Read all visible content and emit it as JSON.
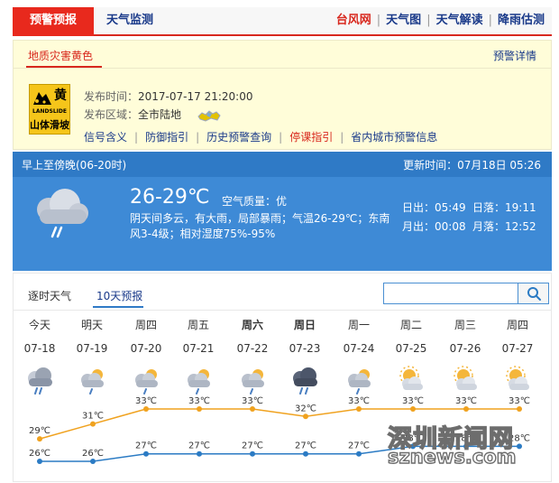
{
  "top_tabs": {
    "active": "预警预报",
    "second": "天气监测",
    "links": [
      {
        "label": "台风网",
        "red": true
      },
      {
        "label": "天气图",
        "red": false
      },
      {
        "label": "天气解读",
        "red": false
      },
      {
        "label": "降雨估测",
        "red": false
      }
    ]
  },
  "warning": {
    "title": "地质灾害黄色",
    "detail_link": "预警详情",
    "badge": {
      "level_char": "黄",
      "en": "LANDSLIDE",
      "cn": "山体滑坡"
    },
    "publish_label": "发布时间：",
    "publish_time": "2017-07-17 21:20:00",
    "area_label": "发布区域：",
    "area": "全市陆地",
    "actions": [
      "信号含义",
      "防御指引",
      "历史预警查询",
      "停课指引",
      "省内城市预警信息"
    ]
  },
  "forecast_panel": {
    "period": "早上至傍晚(06-20时)",
    "update_label": "更新时间：07月18日 05:26",
    "temp": "26-29℃",
    "aqi": "空气质量：优",
    "description": "阴天间多云，有大雨，局部暴雨；气温26-29℃；东南风3-4级；相对湿度75%-95%",
    "sunrise_label": "日出：05:49",
    "sunset_label": "日落：19:11",
    "moonrise_label": "月出：00:08",
    "moonset_label": "月落：12:52"
  },
  "ten_day": {
    "tabs": [
      "逐时天气",
      "10天预报"
    ],
    "search_placeholder": "",
    "days": [
      {
        "week": "今天",
        "date": "07-18",
        "bold": false,
        "icon": "heavy-rain-cloud-icon",
        "high": 29,
        "low": 26
      },
      {
        "week": "明天",
        "date": "07-19",
        "bold": false,
        "icon": "sun-cloud-rain-icon",
        "high": 31,
        "low": 26
      },
      {
        "week": "周四",
        "date": "07-20",
        "bold": false,
        "icon": "sun-cloud-rain-icon",
        "high": 33,
        "low": 27
      },
      {
        "week": "周五",
        "date": "07-21",
        "bold": false,
        "icon": "sun-cloud-rain-icon",
        "high": 33,
        "low": 27
      },
      {
        "week": "周六",
        "date": "07-22",
        "bold": true,
        "icon": "sun-cloud-rain-icon",
        "high": 33,
        "low": 27
      },
      {
        "week": "周日",
        "date": "07-23",
        "bold": true,
        "icon": "thunder-cloud-icon",
        "high": 32,
        "low": 27
      },
      {
        "week": "周一",
        "date": "07-24",
        "bold": false,
        "icon": "sun-cloud-rain-icon",
        "high": 33,
        "low": 27
      },
      {
        "week": "周二",
        "date": "07-25",
        "bold": false,
        "icon": "sun-cloud-icon",
        "high": 33,
        "low": 28
      },
      {
        "week": "周三",
        "date": "07-26",
        "bold": false,
        "icon": "sun-cloud-icon",
        "high": 33,
        "low": 28
      },
      {
        "week": "周四",
        "date": "07-27",
        "bold": false,
        "icon": "sun-cloud-icon",
        "high": 33,
        "low": 28
      }
    ],
    "high_color": "#f0a21f",
    "low_color": "#2b7bc4"
  },
  "watermark": {
    "cn": "深圳新闻网",
    "en": "sznews.com"
  }
}
